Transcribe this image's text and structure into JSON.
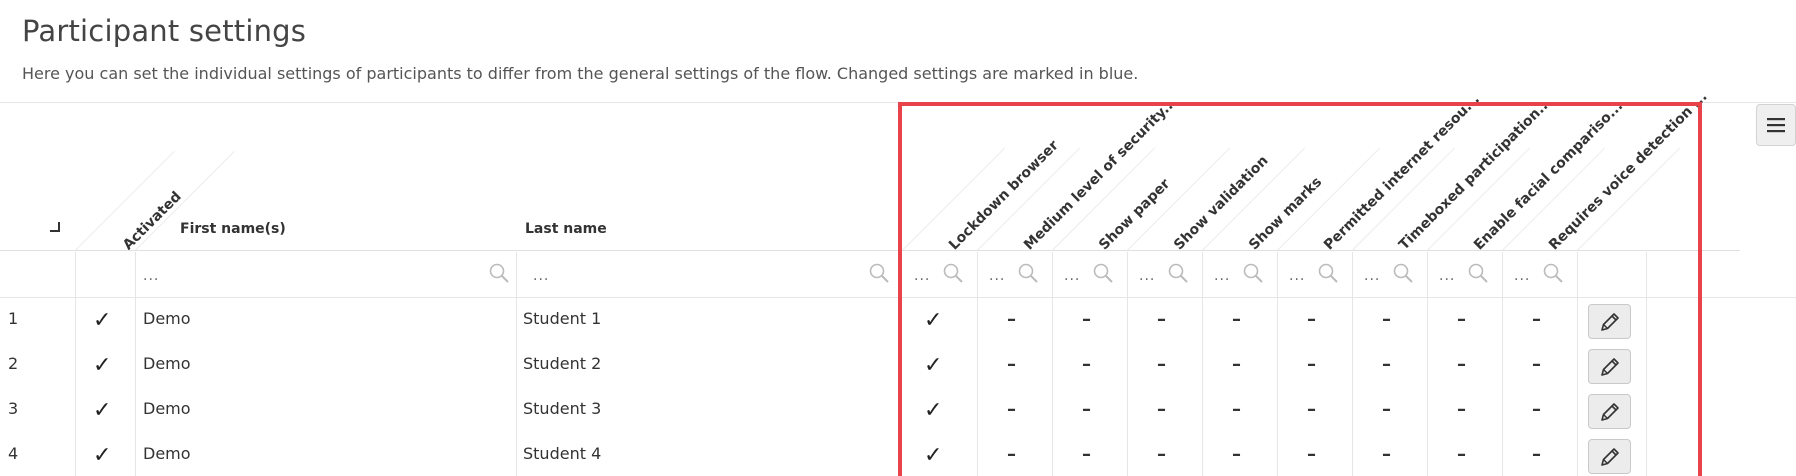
{
  "page": {
    "title": "Participant settings",
    "description": "Here you can set the individual settings of participants to differ from the general settings of the flow. Changed settings are marked in blue."
  },
  "table": {
    "columns": {
      "activated": "Activated",
      "first_name": "First name(s)",
      "last_name": "Last name"
    },
    "setting_columns": [
      "Lockdown browser",
      "Medium level of security...",
      "Show paper",
      "Show validation",
      "Show marks",
      "Permitted internet resou...",
      "Timeboxed participation...",
      "Enable facial compariso...",
      "Requires voice detection ..."
    ],
    "filter_placeholder": "...",
    "rows": [
      {
        "num": "1",
        "activated": "✓",
        "first": "Demo",
        "last": "Student 1",
        "settings": [
          "✓",
          "–",
          "–",
          "–",
          "–",
          "–",
          "–",
          "–",
          "–"
        ]
      },
      {
        "num": "2",
        "activated": "✓",
        "first": "Demo",
        "last": "Student 2",
        "settings": [
          "✓",
          "–",
          "–",
          "–",
          "–",
          "–",
          "–",
          "–",
          "–"
        ]
      },
      {
        "num": "3",
        "activated": "✓",
        "first": "Demo",
        "last": "Student 3",
        "settings": [
          "✓",
          "–",
          "–",
          "–",
          "–",
          "–",
          "–",
          "–",
          "–"
        ]
      },
      {
        "num": "4",
        "activated": "✓",
        "first": "Demo",
        "last": "Student 4",
        "settings": [
          "✓",
          "–",
          "–",
          "–",
          "–",
          "–",
          "–",
          "–",
          "–"
        ]
      }
    ]
  },
  "icons": {
    "menu": "hamburger-menu-icon",
    "search": "magnifier-icon",
    "edit": "pencil-icon",
    "check": "checkmark-icon"
  },
  "colors": {
    "highlight_border": "#e8424b",
    "row_alt": "#f4f4f4"
  }
}
